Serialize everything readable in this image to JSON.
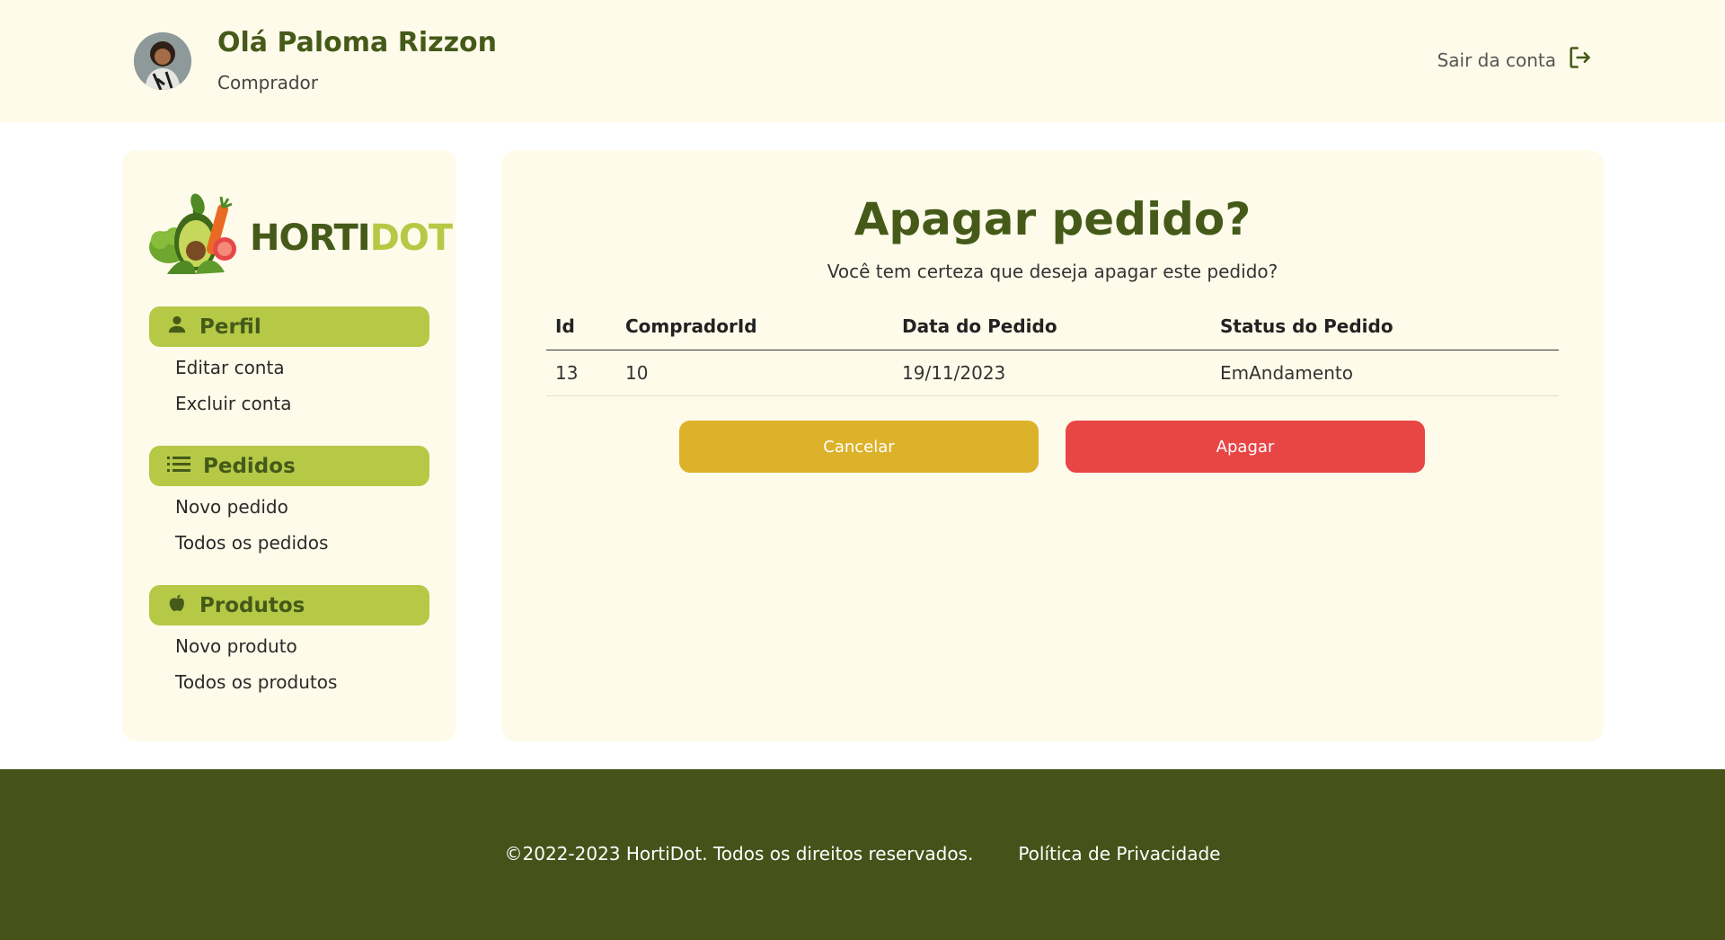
{
  "header": {
    "greeting": "Olá Paloma Rizzon",
    "role": "Comprador",
    "logout_label": "Sair da conta"
  },
  "sidebar": {
    "logo": {
      "part1": "HORTI",
      "part2": "DOT"
    },
    "sections": [
      {
        "title": "Perfil",
        "icon": "person-icon",
        "links": [
          "Editar conta",
          "Excluir conta"
        ]
      },
      {
        "title": "Pedidos",
        "icon": "list-icon",
        "links": [
          "Novo pedido",
          "Todos os pedidos"
        ]
      },
      {
        "title": "Produtos",
        "icon": "apple-icon",
        "links": [
          "Novo produto",
          "Todos os produtos"
        ]
      }
    ]
  },
  "main": {
    "title": "Apagar pedido?",
    "subtitle": "Você tem certeza que deseja apagar este pedido?",
    "table": {
      "headers": [
        "Id",
        "CompradorId",
        "Data do Pedido",
        "Status do Pedido"
      ],
      "rows": [
        [
          "13",
          "10",
          "19/11/2023",
          "EmAndamento"
        ]
      ]
    },
    "cancel_label": "Cancelar",
    "delete_label": "Apagar"
  },
  "footer": {
    "copyright": "©2022-2023 HortiDot. Todos os direitos reservados.",
    "privacy": "Política de Privacidade"
  },
  "colors": {
    "brand_dark": "#455a19",
    "brand_light": "#b5c947",
    "panel_bg": "#fffbea",
    "cancel": "#ddb22b",
    "delete": "#e84545",
    "footer_bg": "#455219"
  }
}
